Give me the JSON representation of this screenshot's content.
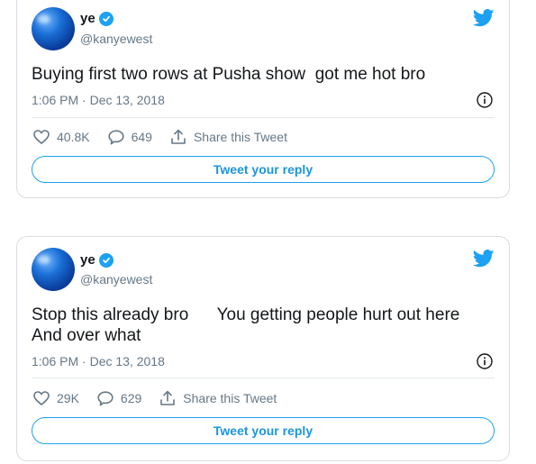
{
  "colors": {
    "accent": "#1da1f2",
    "muted": "#657786",
    "border": "#d9dde1"
  },
  "tweets": [
    {
      "name": "ye",
      "handle": "@kanyewest",
      "text": "Buying first two rows at Pusha show  got me hot bro",
      "timestamp": "1:06 PM · Dec 13, 2018",
      "likes": "40.8K",
      "replies": "649",
      "share_label": "Share this Tweet",
      "reply_label": "Tweet your reply"
    },
    {
      "name": "ye",
      "handle": "@kanyewest",
      "text": "Stop this already bro      You getting people hurt out here\nAnd over what",
      "timestamp": "1:06 PM · Dec 13, 2018",
      "likes": "29K",
      "replies": "629",
      "share_label": "Share this Tweet",
      "reply_label": "Tweet your reply"
    }
  ],
  "icons": {
    "verified": "verified-badge-icon",
    "bird": "twitter-bird-icon",
    "info": "info-icon",
    "like": "heart-icon",
    "reply": "reply-bubble-icon",
    "share": "share-icon"
  }
}
